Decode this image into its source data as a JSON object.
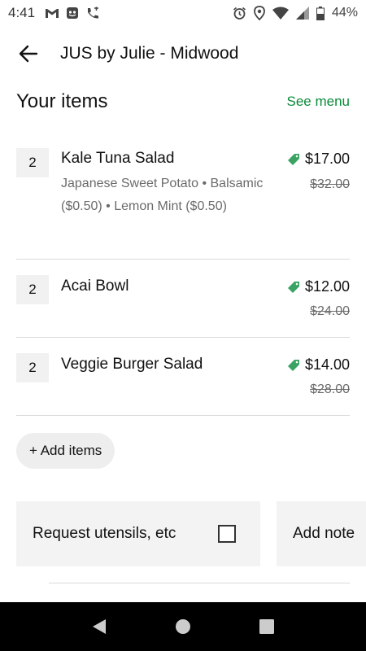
{
  "status_bar": {
    "time": "4:41",
    "left_icons": [
      "gmail-icon",
      "shield-app-icon",
      "phone-call-icon"
    ],
    "right_icons": [
      "alarm-icon",
      "location-icon",
      "wifi-icon",
      "signal-icon",
      "battery-icon"
    ],
    "battery_percent": "44%"
  },
  "header": {
    "back_icon": "arrow-left-icon",
    "title": "JUS by Julie - Midwood"
  },
  "section": {
    "title": "Your items",
    "see_menu": "See menu"
  },
  "items": [
    {
      "qty": "2",
      "name": "Kale Tuna Salad",
      "options": "Japanese Sweet Potato • Balsamic ($0.50) • Lemon Mint ($0.50)",
      "price": "$17.00",
      "original_price": "$32.00"
    },
    {
      "qty": "2",
      "name": "Acai Bowl",
      "options": "",
      "price": "$12.00",
      "original_price": "$24.00"
    },
    {
      "qty": "2",
      "name": "Veggie Burger Salad",
      "options": "",
      "price": "$14.00",
      "original_price": "$28.00"
    }
  ],
  "add_items_label": "+ Add items",
  "options": {
    "utensils_label": "Request utensils, etc",
    "note_label": "Add note"
  },
  "colors": {
    "accent_green": "#0a8a3a",
    "tag_green": "#3aa364",
    "nav_bar": "#000000"
  },
  "nav_bar": {
    "icons": [
      "back-triangle-icon",
      "home-circle-icon",
      "recents-square-icon"
    ]
  }
}
